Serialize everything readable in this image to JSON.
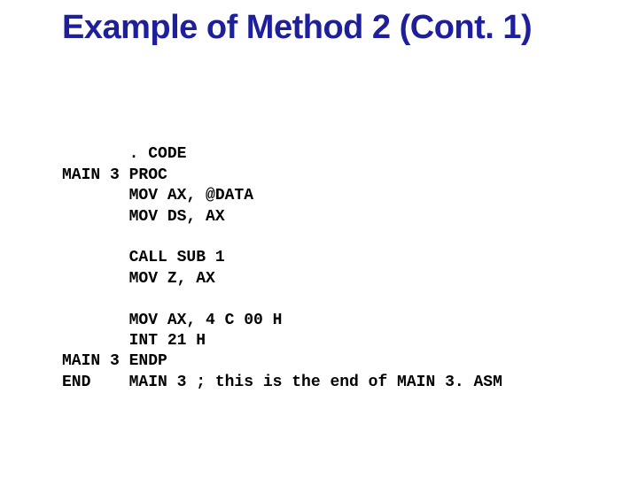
{
  "title": "Example of Method 2 (Cont. 1)",
  "code": {
    "l1": "       . CODE",
    "l2": "MAIN 3 PROC",
    "l3": "       MOV AX, @DATA",
    "l4": "       MOV DS, AX",
    "l5": "",
    "l6": "       CALL SUB 1",
    "l7": "       MOV Z, AX",
    "l8": "",
    "l9": "       MOV AX, 4 C 00 H",
    "l10": "       INT 21 H",
    "l11": "MAIN 3 ENDP",
    "l12": "END    MAIN 3 ; this is the end of MAIN 3. ASM"
  }
}
